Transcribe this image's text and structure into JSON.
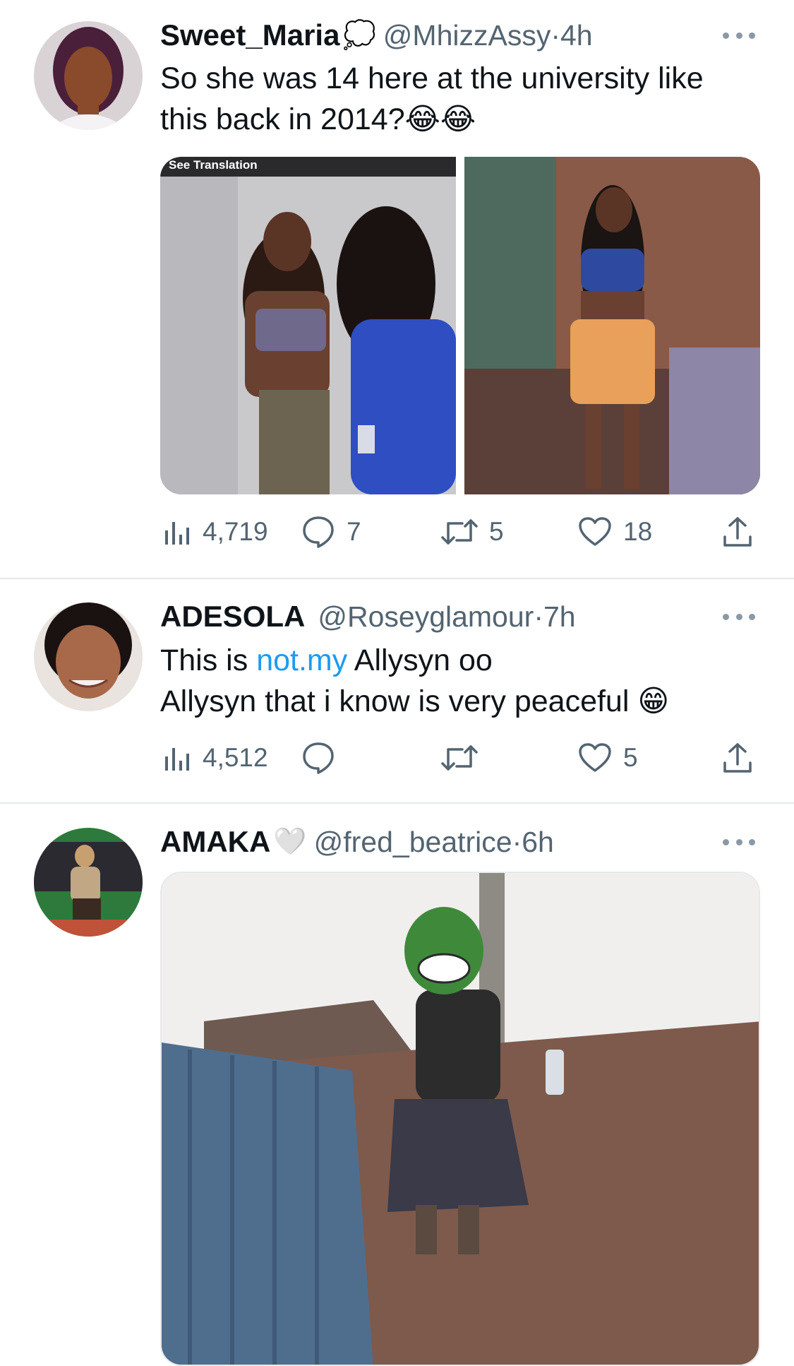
{
  "tweets": [
    {
      "name": "Sweet_Maria",
      "name_emoji": "💭",
      "handle": "@MhizzAssy",
      "time": "4h",
      "text_lines": [
        "So she was 14 here at the university like",
        "this back in 2014?😂😂"
      ],
      "media_caption": "See Translation",
      "stats": {
        "views": "4,719",
        "replies": "7",
        "retweets": "5",
        "likes": "18"
      }
    },
    {
      "name": "ADESOLA",
      "handle": "@Roseyglamour",
      "time": "7h",
      "text_line1_pre": "This is ",
      "text_line1_link": "not.my",
      "text_line1_post": " Allysyn oo",
      "text_line2": "Allysyn that i know is very peaceful 😁",
      "stats": {
        "views": "4,512",
        "replies": "",
        "retweets": "",
        "likes": "5"
      }
    },
    {
      "name": "AMAKA",
      "name_emoji": "🤍",
      "handle": "@fred_beatrice",
      "time": "6h"
    }
  ],
  "separator": " · ",
  "colors": {
    "link": "#1d9bf0",
    "secondary": "#536471",
    "divider": "#e6e9ec"
  },
  "icons": [
    "views-icon",
    "reply-icon",
    "retweet-icon",
    "like-icon",
    "share-icon",
    "more-icon"
  ]
}
